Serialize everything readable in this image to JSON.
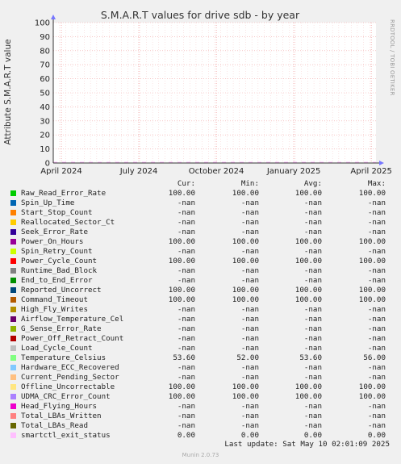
{
  "chart_data": {
    "type": "line",
    "title": "S.M.A.R.T values for drive sdb - by year",
    "ylabel": "Attribute S.M.A.R.T value",
    "xlabel": "",
    "ylim": [
      0,
      100
    ],
    "y_ticks": [
      "0",
      "10",
      "20",
      "30",
      "40",
      "50",
      "60",
      "70",
      "80",
      "90",
      "100"
    ],
    "x_tick_labels": [
      "April 2024",
      "July 2024",
      "October 2024",
      "January 2025",
      "April 2025"
    ],
    "grid": true,
    "series": []
  },
  "side_text": "RRDTOOL / TOBI OETIKER",
  "legend_header": {
    "cur": "Cur:",
    "min": "Min:",
    "avg": "Avg:",
    "max": "Max:"
  },
  "legend": [
    {
      "name": "Raw_Read_Error_Rate",
      "color": "#00cc00",
      "cur": "100.00",
      "min": "100.00",
      "avg": "100.00",
      "max": "100.00"
    },
    {
      "name": "Spin_Up_Time",
      "color": "#0066b3",
      "cur": "-nan",
      "min": "-nan",
      "avg": "-nan",
      "max": "-nan"
    },
    {
      "name": "Start_Stop_Count",
      "color": "#ff8000",
      "cur": "-nan",
      "min": "-nan",
      "avg": "-nan",
      "max": "-nan"
    },
    {
      "name": "Reallocated_Sector_Ct",
      "color": "#ffcc00",
      "cur": "-nan",
      "min": "-nan",
      "avg": "-nan",
      "max": "-nan"
    },
    {
      "name": "Seek_Error_Rate",
      "color": "#330099",
      "cur": "-nan",
      "min": "-nan",
      "avg": "-nan",
      "max": "-nan"
    },
    {
      "name": "Power_On_Hours",
      "color": "#990099",
      "cur": "100.00",
      "min": "100.00",
      "avg": "100.00",
      "max": "100.00"
    },
    {
      "name": "Spin_Retry_Count",
      "color": "#ccff00",
      "cur": "-nan",
      "min": "-nan",
      "avg": "-nan",
      "max": "-nan"
    },
    {
      "name": "Power_Cycle_Count",
      "color": "#ff0000",
      "cur": "100.00",
      "min": "100.00",
      "avg": "100.00",
      "max": "100.00"
    },
    {
      "name": "Runtime_Bad_Block",
      "color": "#808080",
      "cur": "-nan",
      "min": "-nan",
      "avg": "-nan",
      "max": "-nan"
    },
    {
      "name": "End_to_End_Error",
      "color": "#008f00",
      "cur": "-nan",
      "min": "-nan",
      "avg": "-nan",
      "max": "-nan"
    },
    {
      "name": "Reported_Uncorrect",
      "color": "#00487d",
      "cur": "100.00",
      "min": "100.00",
      "avg": "100.00",
      "max": "100.00"
    },
    {
      "name": "Command_Timeout",
      "color": "#b35a00",
      "cur": "100.00",
      "min": "100.00",
      "avg": "100.00",
      "max": "100.00"
    },
    {
      "name": "High_Fly_Writes",
      "color": "#b38f00",
      "cur": "-nan",
      "min": "-nan",
      "avg": "-nan",
      "max": "-nan"
    },
    {
      "name": "Airflow_Temperature_Cel",
      "color": "#6b006b",
      "cur": "-nan",
      "min": "-nan",
      "avg": "-nan",
      "max": "-nan"
    },
    {
      "name": "G_Sense_Error_Rate",
      "color": "#8fb300",
      "cur": "-nan",
      "min": "-nan",
      "avg": "-nan",
      "max": "-nan"
    },
    {
      "name": "Power_Off_Retract_Count",
      "color": "#b30000",
      "cur": "-nan",
      "min": "-nan",
      "avg": "-nan",
      "max": "-nan"
    },
    {
      "name": "Load_Cycle_Count",
      "color": "#bebebe",
      "cur": "-nan",
      "min": "-nan",
      "avg": "-nan",
      "max": "-nan"
    },
    {
      "name": "Temperature_Celsius",
      "color": "#80ff80",
      "cur": "53.60",
      "min": "52.00",
      "avg": "53.60",
      "max": "56.00"
    },
    {
      "name": "Hardware_ECC_Recovered",
      "color": "#80c9ff",
      "cur": "-nan",
      "min": "-nan",
      "avg": "-nan",
      "max": "-nan"
    },
    {
      "name": "Current_Pending_Sector",
      "color": "#ffc080",
      "cur": "-nan",
      "min": "-nan",
      "avg": "-nan",
      "max": "-nan"
    },
    {
      "name": "Offline_Uncorrectable",
      "color": "#ffe680",
      "cur": "100.00",
      "min": "100.00",
      "avg": "100.00",
      "max": "100.00"
    },
    {
      "name": "UDMA_CRC_Error_Count",
      "color": "#aa80ff",
      "cur": "100.00",
      "min": "100.00",
      "avg": "100.00",
      "max": "100.00"
    },
    {
      "name": "Head_Flying_Hours",
      "color": "#ee00cc",
      "cur": "-nan",
      "min": "-nan",
      "avg": "-nan",
      "max": "-nan"
    },
    {
      "name": "Total_LBAs_Written",
      "color": "#ff8080",
      "cur": "-nan",
      "min": "-nan",
      "avg": "-nan",
      "max": "-nan"
    },
    {
      "name": "Total_LBAs_Read",
      "color": "#666600",
      "cur": "-nan",
      "min": "-nan",
      "avg": "-nan",
      "max": "-nan"
    },
    {
      "name": "smartctl_exit_status",
      "color": "#ffbfff",
      "cur": "0.00",
      "min": "0.00",
      "avg": "0.00",
      "max": "0.00"
    }
  ],
  "last_update": "Last update: Sat May 10 02:01:09 2025",
  "footer": "Munin 2.0.73"
}
